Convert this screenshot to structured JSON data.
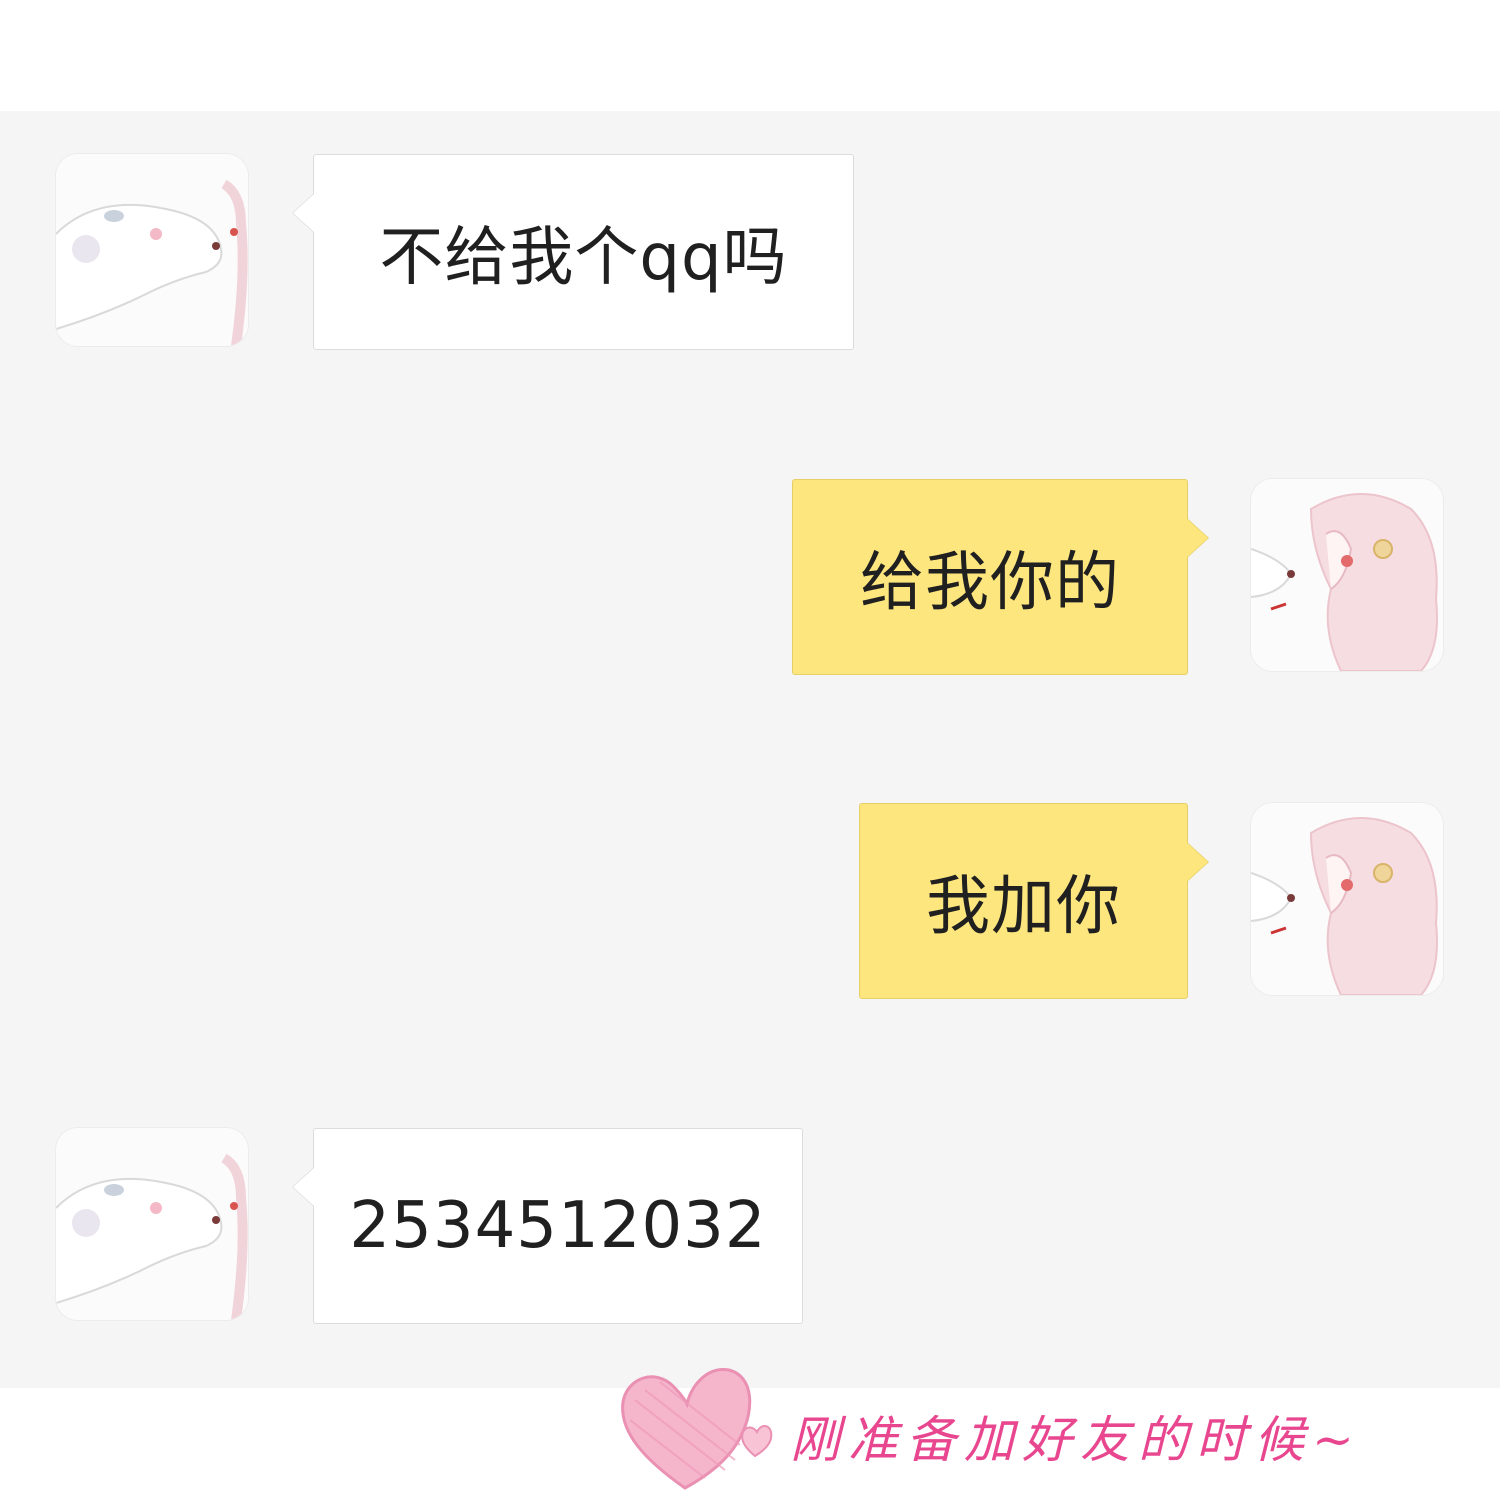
{
  "messages": [
    {
      "direction": "incoming",
      "text": "不给我个qq吗"
    },
    {
      "direction": "outgoing",
      "text": "给我你的"
    },
    {
      "direction": "outgoing",
      "text": "我加你"
    },
    {
      "direction": "incoming",
      "text": "2534512032"
    }
  ],
  "caption": {
    "text": "刚准备加好友的时候~"
  },
  "colors": {
    "chat_background": "#f5f5f5",
    "incoming_bubble": "#ffffff",
    "outgoing_bubble": "#fde67d",
    "caption": "#e8478f",
    "heart": "#f2a7c3"
  },
  "icons": {
    "contact_avatar": "bunny-avatar-icon",
    "self_avatar": "anime-girl-avatar-icon",
    "decoration": "heart-icon"
  }
}
